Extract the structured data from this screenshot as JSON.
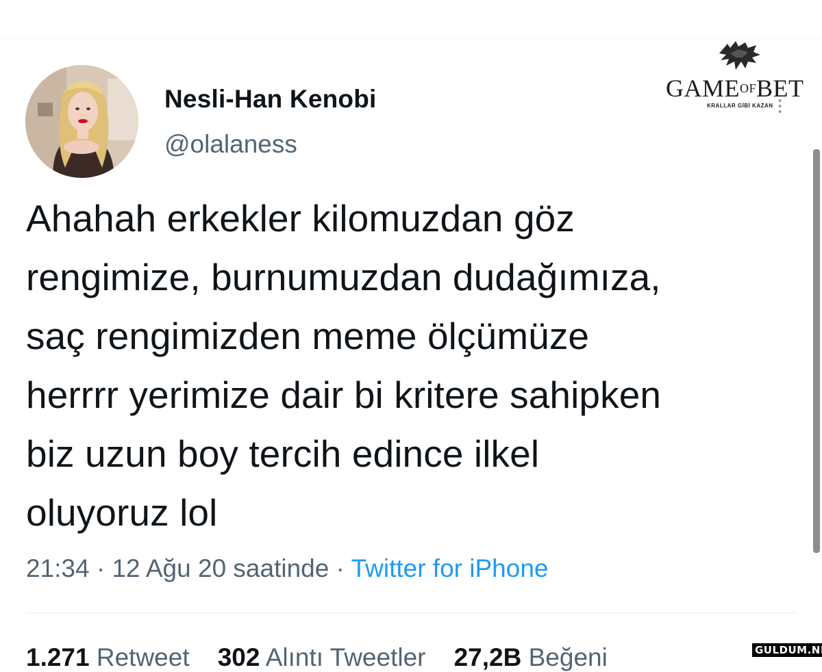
{
  "author": {
    "display_name": "Nesli-Han Kenobi",
    "handle": "@olalaness",
    "avatar_icon": "profile-photo"
  },
  "brand": {
    "name_part1": "GAME",
    "name_of": "OF",
    "name_part2": "BET",
    "tagline": "KRALLAR GİBİ KAZAN",
    "icon": "wolf-head-icon"
  },
  "tweet": {
    "text": "Ahahah erkekler kilomuzdan göz\nrengimize, burnumuzdan dudağımıza,\nsaç rengimizden meme ölçümüze\nherrrr yerimize dair bi kritere sahipken\nbiz uzun boy tercih edince ilkel\noluyoruz lol",
    "time": "21:34",
    "separator": "·",
    "date": "12 Ağu 20 saatinde",
    "source": "Twitter for iPhone"
  },
  "stats": {
    "retweets_count": "1.271",
    "retweets_label": "Retweet",
    "quotes_count": "302",
    "quotes_label": "Alıntı Tweetler",
    "likes_count": "27,2B",
    "likes_label": "Beğeni"
  },
  "watermark": "GULDUM.NET",
  "colors": {
    "text": "#0f1419",
    "secondary": "#536471",
    "link": "#1d9bf0"
  }
}
